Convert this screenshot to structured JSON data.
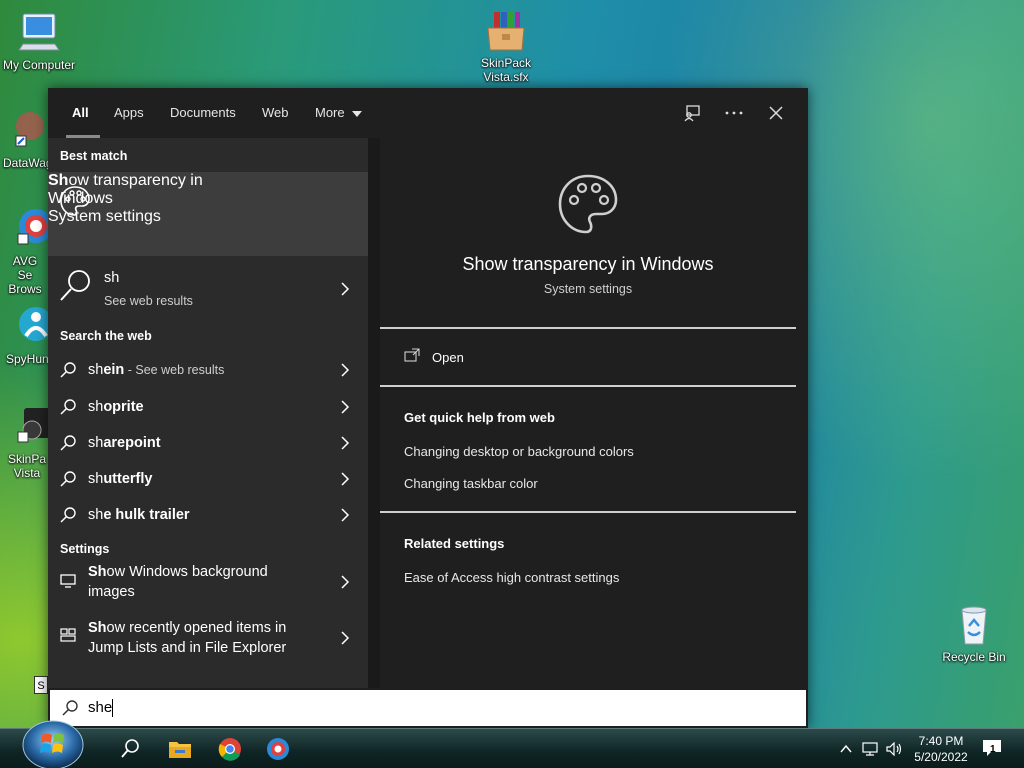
{
  "desktop": {
    "icons": [
      {
        "label": "My Computer"
      },
      {
        "label": "SkinPack Vista.sfx"
      },
      {
        "label": "DataWag"
      },
      {
        "label": "AVG Se Brows"
      },
      {
        "label": "SpyHun"
      },
      {
        "label": "SkinPa Vista"
      },
      {
        "label": "Recycle Bin"
      }
    ],
    "stub_label": "S"
  },
  "search_panel": {
    "tabs": [
      {
        "label": "All"
      },
      {
        "label": "Apps"
      },
      {
        "label": "Documents"
      },
      {
        "label": "Web"
      },
      {
        "label": "More"
      }
    ],
    "sections": {
      "best_match": "Best match",
      "search_web": "Search the web",
      "settings": "Settings"
    },
    "best_match": {
      "title_bold": "Sh",
      "title_rest": "ow transparency in",
      "title_line2": "Windows",
      "subtitle": "System settings"
    },
    "web_result": {
      "title": "sh",
      "subtitle": "See web results"
    },
    "web_suggestions": [
      {
        "typed": "sh",
        "rest": "ein",
        "hint": " - See web results"
      },
      {
        "typed": "sh",
        "rest": "oprite",
        "hint": ""
      },
      {
        "typed": "sh",
        "rest": "arepoint",
        "hint": ""
      },
      {
        "typed": "sh",
        "rest": "utterfly",
        "hint": ""
      },
      {
        "typed": "sh",
        "rest": "e hulk trailer",
        "hint": ""
      }
    ],
    "settings_results": [
      {
        "bold": "Sh",
        "rest": "ow Windows background",
        "line2": "images"
      },
      {
        "bold": "Sh",
        "rest": "ow recently opened items in",
        "line2": "Jump Lists and in File Explorer"
      }
    ],
    "detail": {
      "title": "Show transparency in Windows",
      "subtitle": "System settings",
      "open_label": "Open",
      "quick_help_heading": "Get quick help from web",
      "quick_help_links": [
        "Changing desktop or background colors",
        "Changing taskbar color"
      ],
      "related_heading": "Related settings",
      "related_links": [
        "Ease of Access high contrast settings"
      ]
    },
    "query": "she"
  },
  "taskbar": {
    "time": "7:40 PM",
    "date": "5/20/2022",
    "notification_count": "1"
  }
}
